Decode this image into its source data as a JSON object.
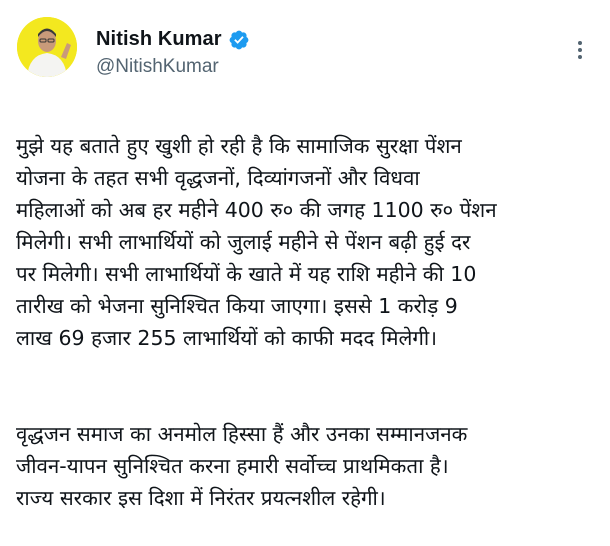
{
  "author": {
    "display_name": "Nitish Kumar",
    "handle": "@NitishKumar",
    "verified": true
  },
  "icons": {
    "verified": "verified-badge-icon",
    "more": "more-options-icon"
  },
  "colors": {
    "verified_blue": "#1d9bf0",
    "avatar_background": "#f3e81f",
    "secondary_text": "#536471"
  },
  "tweet": {
    "paragraphs": [
      "मुझे यह बताते हुए खुशी हो रही है कि सामाजिक सुरक्षा पेंशन\nयोजना के तहत सभी वृद्धजनों, दिव्यांगजनों और विधवा\nमहिलाओं को अब हर महीने 400 रु० की जगह 1100 रु० पेंशन\nमिलेगी। सभी लाभार्थियों को जुलाई महीने से पेंशन बढ़ी हुई दर\nपर मिलेगी। सभी लाभार्थियों के खाते में यह राशि महीने की 10\nतारीख को भेजना सुनिश्चित किया जाएगा। इससे 1 करोड़ 9\nलाख 69 हजार 255 लाभार्थियों को काफी मदद मिलेगी।",
      "वृद्धजन समाज का अनमोल हिस्सा हैं और उनका सम्मानजनक\nजीवन-यापन सुनिश्चित करना हमारी सर्वोच्च प्राथमिकता है।\nराज्य सरकार इस दिशा में निरंतर प्रयत्नशील रहेगी।"
    ]
  }
}
